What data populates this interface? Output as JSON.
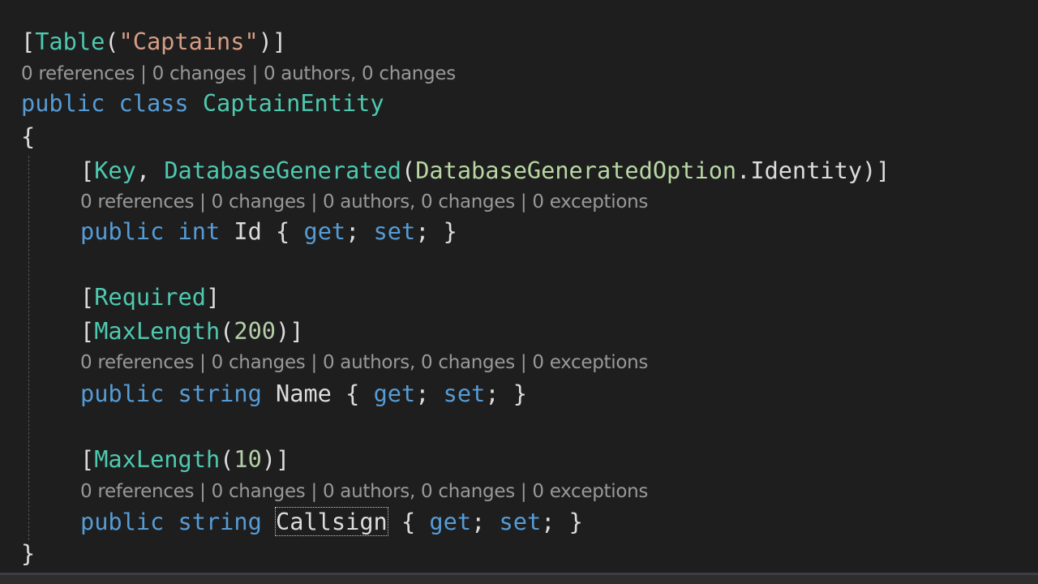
{
  "code": {
    "attr_table": {
      "open": "[",
      "type": "Table",
      "paren_open": "(",
      "string": "\"Captains\"",
      "paren_close": ")",
      "close": "]"
    },
    "lens_class": "0 references | 0 changes | 0 authors, 0 changes",
    "class_decl": {
      "kw_public": "public",
      "kw_class": "class",
      "name": "CaptainEntity"
    },
    "brace_open": "{",
    "attr_key": {
      "open": "[",
      "key": "Key",
      "comma": ", ",
      "dbgen": "DatabaseGenerated",
      "paren_open": "(",
      "enum_type": "DatabaseGeneratedOption",
      "dot": ".",
      "enum_member": "Identity",
      "close": ")]"
    },
    "lens_id": "0 references | 0 changes | 0 authors, 0 changes | 0 exceptions",
    "prop_id": {
      "kw_public": "public",
      "kw_type": "int",
      "name": "Id",
      "open": "{",
      "get": "get",
      "semi1": ";",
      "set": "set",
      "semi2": ";",
      "close": "}"
    },
    "attr_required": {
      "open": "[",
      "type": "Required",
      "close": "]"
    },
    "attr_maxlen_name": {
      "open": "[",
      "type": "MaxLength",
      "paren_open": "(",
      "value": "200",
      "close": ")]"
    },
    "lens_name": "0 references | 0 changes | 0 authors, 0 changes | 0 exceptions",
    "prop_name": {
      "kw_public": "public",
      "kw_type": "string",
      "name": "Name",
      "open": "{",
      "get": "get",
      "semi1": ";",
      "set": "set",
      "semi2": ";",
      "close": "}"
    },
    "attr_maxlen_callsign": {
      "open": "[",
      "type": "MaxLength",
      "paren_open": "(",
      "value": "10",
      "close": ")]"
    },
    "lens_callsign": "0 references | 0 changes | 0 authors, 0 changes | 0 exceptions",
    "prop_callsign": {
      "kw_public": "public",
      "kw_type": "string",
      "name": "Callsign",
      "open": "{",
      "get": "get",
      "semi1": ";",
      "set": "set",
      "semi2": ";",
      "close": "}"
    },
    "brace_close": "}"
  },
  "colors": {
    "background": "#1e1e1e",
    "keyword": "#569cd6",
    "type": "#4ec9b0",
    "string": "#d69d85",
    "number": "#b5cea8",
    "codelens": "#999999"
  }
}
